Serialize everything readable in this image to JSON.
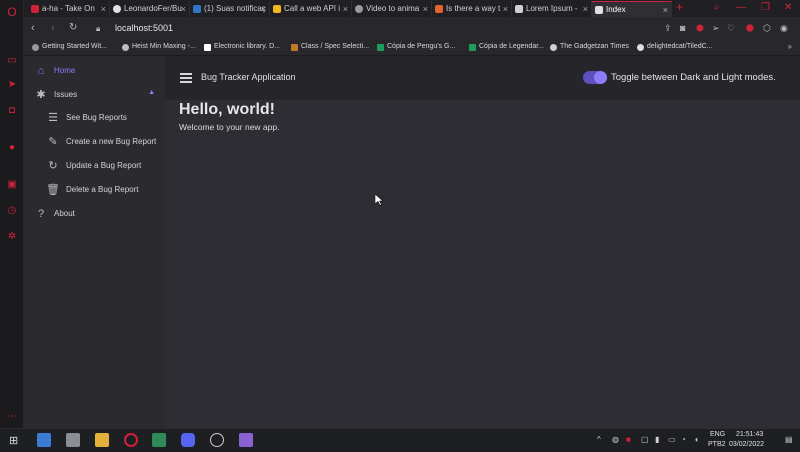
{
  "browser": {
    "tabs": [
      {
        "label": "a-ha - Take On",
        "color": "#d0233a"
      },
      {
        "label": "LeonardoFer/Bu",
        "color": "#e0e0e0"
      },
      {
        "label": "(1) Suas notificaç",
        "color": "#2f76c9"
      },
      {
        "label": "Call a web API i",
        "color": "#f1b71c"
      },
      {
        "label": "Video to anima",
        "color": "#9a9a9a"
      },
      {
        "label": "Is there a way t",
        "color": "#e0642f"
      },
      {
        "label": "Lorem Ipsum -",
        "color": "#cfcfcf"
      },
      {
        "label": "Index",
        "color": "#e0e0e0"
      }
    ],
    "url": "localhost:5001",
    "bookmarks": [
      {
        "label": "Getting Started Wit...",
        "color": "#9a9a9a"
      },
      {
        "label": "Heist Min Maxing -...",
        "color": "#bdbdbd"
      },
      {
        "label": "Electronic library. D...",
        "color": "#ffffff"
      },
      {
        "label": "Class / Spec Selecti...",
        "color": "#c07a2a"
      },
      {
        "label": "Cópia de Pengu's G...",
        "color": "#1e9e5a"
      },
      {
        "label": "Cópia de Legendar...",
        "color": "#1e9e5a"
      },
      {
        "label": "The Gadgetzan Times",
        "color": "#cfcfcf"
      },
      {
        "label": "delightedcat/TiledC...",
        "color": "#e0e0e0"
      }
    ]
  },
  "sidebar": {
    "items": [
      {
        "label": "Home",
        "icon": "home-icon"
      },
      {
        "label": "Issues",
        "icon": "bug-icon"
      },
      {
        "label": "See Bug Reports",
        "icon": "list-icon"
      },
      {
        "label": "Create a new Bug Report",
        "icon": "pencil-icon"
      },
      {
        "label": "Update a Bug Report",
        "icon": "refresh-icon"
      },
      {
        "label": "Delete a Bug Report",
        "icon": "trash-icon"
      },
      {
        "label": "About",
        "icon": "question-icon"
      }
    ]
  },
  "header": {
    "title": "Bug Tracker Application",
    "toggle_label": "Toggle between Dark and Light modes."
  },
  "main": {
    "heading": "Hello, world!",
    "subtext": "Welcome to your new app."
  },
  "taskbar": {
    "lang_top": "ENG",
    "lang_bottom": "PTB2",
    "time": "21:51:43",
    "date": "03/02/2022"
  },
  "colors": {
    "accent": "#8f7cf7",
    "opera_red": "#d0233a"
  }
}
